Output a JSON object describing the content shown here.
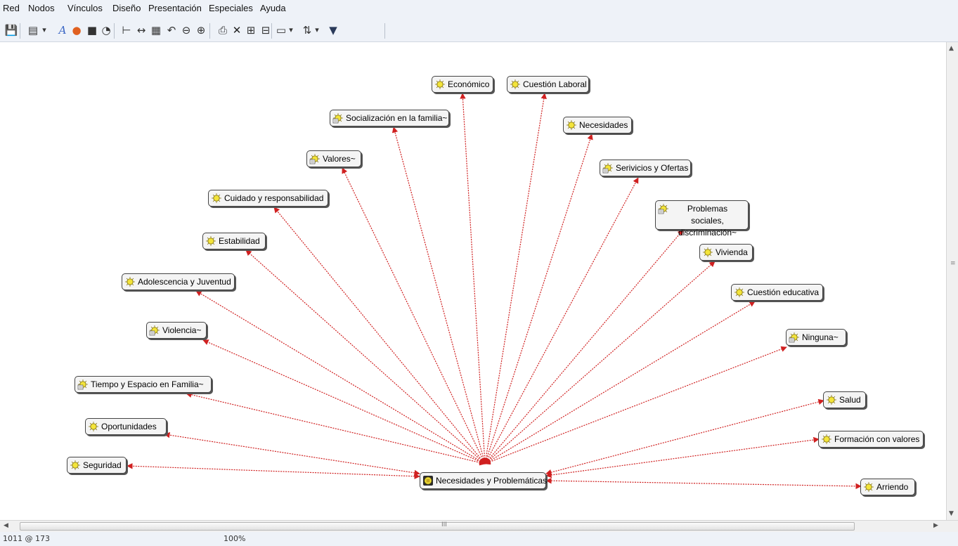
{
  "menu": [
    "Red",
    "Nodos",
    "Vínculos",
    "Diseño",
    "Presentación",
    "Especiales",
    "Ayuda"
  ],
  "toolbar_icons": [
    "save-icon",
    "new-node-icon",
    "dropdown-arrow-icon",
    "font-icon",
    "color-wheel-icon",
    "node-color-icon",
    "comment-icon",
    "hierarchy-layout-icon",
    "distribute-horizontal-icon",
    "grid-icon",
    "undo-icon",
    "zoom-out-icon",
    "zoom-in-icon",
    "print-icon",
    "delete-icon",
    "link-nodes-icon",
    "unlink-nodes-icon",
    "display-options-icon",
    "dropdown-arrow-icon",
    "sort-icon",
    "dropdown-arrow-icon",
    "filter-icon"
  ],
  "network": {
    "center": {
      "label": "Necesidades y Problemáticas",
      "icon": "family-node-icon"
    },
    "nodes": [
      {
        "id": "economico",
        "label": "Económico",
        "icon": "code-icon"
      },
      {
        "id": "cuestion-laboral",
        "label": "Cuestión Laboral",
        "icon": "code-icon"
      },
      {
        "id": "socializacion",
        "label": "Socialización en la familia~",
        "icon": "commented-code-icon"
      },
      {
        "id": "necesidades",
        "label": "Necesidades",
        "icon": "code-icon"
      },
      {
        "id": "valores",
        "label": "Valores~",
        "icon": "commented-code-icon"
      },
      {
        "id": "servicios",
        "label": "Serivicios y Ofertas",
        "icon": "commented-code-icon"
      },
      {
        "id": "cuidado",
        "label": "Cuidado y responsabilidad",
        "icon": "code-icon"
      },
      {
        "id": "problemas",
        "label": "Problemas sociales,\ndiscriminación~",
        "icon": "commented-code-icon"
      },
      {
        "id": "estabilidad",
        "label": "Estabilidad",
        "icon": "code-icon"
      },
      {
        "id": "vivienda",
        "label": "Vivienda",
        "icon": "code-icon"
      },
      {
        "id": "adolescencia",
        "label": "Adolescencia y Juventud",
        "icon": "code-icon"
      },
      {
        "id": "educativa",
        "label": "Cuestión educativa",
        "icon": "code-icon"
      },
      {
        "id": "violencia",
        "label": "Violencia~",
        "icon": "commented-code-icon"
      },
      {
        "id": "ninguna",
        "label": "Ninguna~",
        "icon": "commented-code-icon"
      },
      {
        "id": "tiempo",
        "label": "Tiempo  y Espacio en Familia~",
        "icon": "commented-code-icon"
      },
      {
        "id": "salud",
        "label": "Salud",
        "icon": "code-icon"
      },
      {
        "id": "oportunidades",
        "label": "Oportunidades",
        "icon": "code-icon"
      },
      {
        "id": "formacion",
        "label": "Formación con valores",
        "icon": "code-icon"
      },
      {
        "id": "seguridad",
        "label": "Seguridad",
        "icon": "code-icon"
      },
      {
        "id": "arriendo",
        "label": "Arriendo",
        "icon": "code-icon"
      }
    ],
    "edge_color": "#d02020"
  },
  "scrollbar_grip": "III",
  "status": {
    "coords": "1011 @ 173",
    "zoom": "100%"
  },
  "colors": {
    "chrome": "#eef2f8",
    "node_fill": "#f4f4f4",
    "icon_yellow": "#f3e43a"
  }
}
